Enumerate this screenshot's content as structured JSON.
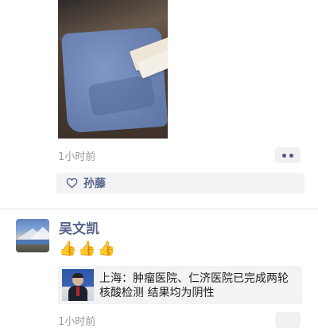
{
  "post1": {
    "time": "1小时前",
    "likes": [
      "孙藤"
    ]
  },
  "post2": {
    "author": "吴文凯",
    "emojis": [
      "👍",
      "👍",
      "👍"
    ],
    "link_title": "上海：肿瘤医院、仁济医院已完成两轮核酸检测 结果均为阴性",
    "time": "1小时前"
  },
  "icons": {
    "more": "more-dots-icon",
    "like": "heart-icon"
  },
  "colors": {
    "name_link": "#56638a",
    "time": "#9a9a9a",
    "panel_bg": "#f3f3f5"
  }
}
